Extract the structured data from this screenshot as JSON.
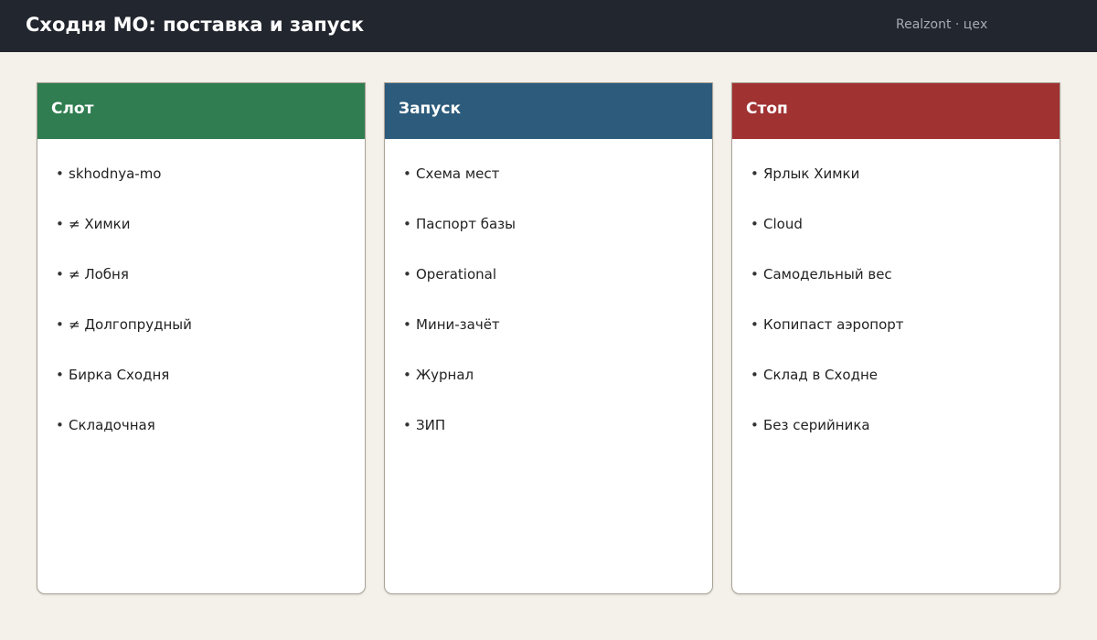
{
  "header": {
    "title": "Сходня МО: поставка и запуск",
    "brand": "Realzont · цех"
  },
  "panels": [
    {
      "title": "Слот",
      "color": "#2f7d50",
      "items": [
        "skhodnya-mo",
        "≠ Химки",
        "≠ Лобня",
        "≠ Долгопрудный",
        "Бирка Сходня",
        "Складочная"
      ]
    },
    {
      "title": "Запуск",
      "color": "#2d5b7b",
      "items": [
        "Схема мест",
        "Паспорт базы",
        "Operational",
        "Мини-зачёт",
        "Журнал",
        "ЗИП"
      ]
    },
    {
      "title": "Стоп",
      "color": "#a03232",
      "items": [
        "Ярлык Химки",
        "Cloud",
        "Самодельный вес",
        "Копипаст аэропорт",
        "Склад в Сходне",
        "Без серийника"
      ]
    }
  ],
  "bullet": "•"
}
